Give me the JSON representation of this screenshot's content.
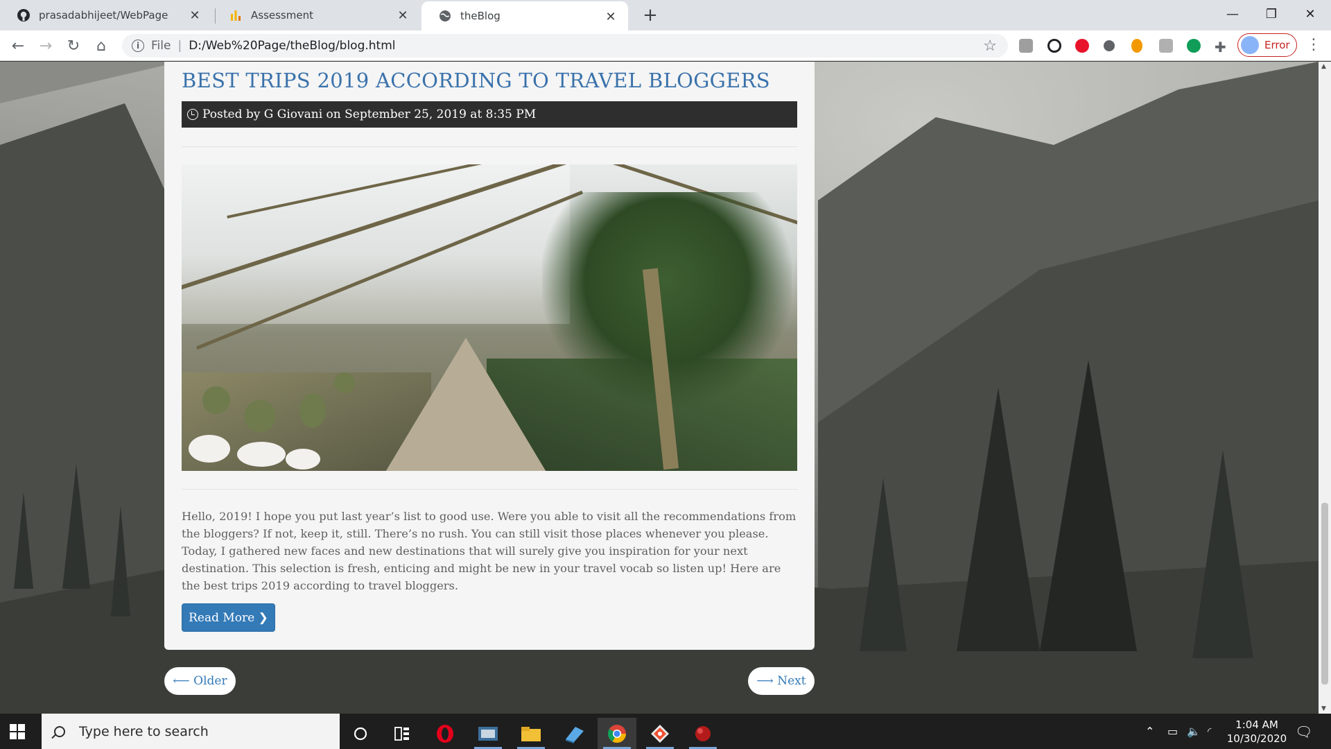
{
  "browser": {
    "tabs": [
      {
        "label": "prasadabhijeet/WebPage",
        "icon": "github-icon"
      },
      {
        "label": "Assessment",
        "icon": "bar-chart-icon"
      },
      {
        "label": "theBlog",
        "icon": "globe-icon",
        "active": true
      }
    ],
    "address": {
      "scheme_label": "File",
      "url": "D:/Web%20Page/theBlog/blog.html"
    },
    "profile_label": "Error"
  },
  "post": {
    "title": "BEST TRIPS 2019 ACCORDING TO TRAVEL BLOGGERS",
    "meta": "Posted by G Giovani on September 25, 2019 at 8:35 PM",
    "excerpt": "Hello, 2019! I hope you put last year’s list to good use. Were you able to visit all the recommendations from the bloggers? If not, keep it, still. There’s no rush. You can still visit those places whenever you please. Today, I gathered new faces and new destinations that will surely give you inspiration for your next destination. This selection is fresh, enticing and might be new in your travel vocab so listen up! Here are the best trips 2019 according to travel bloggers.",
    "read_more": "Read More ❯"
  },
  "pager": {
    "older": "⟵ Older",
    "next": "⟶ Next"
  },
  "taskbar": {
    "search_placeholder": "Type here to search",
    "time": "1:04 AM",
    "date": "10/30/2020"
  },
  "colors": {
    "accent": "#337ab7",
    "title": "#3a72ab",
    "meta_bg": "#2e2e2e"
  }
}
